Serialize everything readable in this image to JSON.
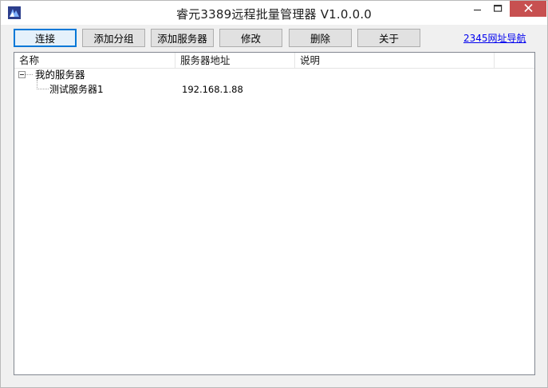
{
  "window": {
    "title": "睿元3389远程批量管理器 V1.0.0.0"
  },
  "toolbar": {
    "connect_label": "连接",
    "add_group_label": "添加分组",
    "add_server_label": "添加服务器",
    "edit_label": "修改",
    "delete_label": "删除",
    "about_label": "关于",
    "nav_link_label": "2345网址导航"
  },
  "list": {
    "columns": [
      "名称",
      "服务器地址",
      "说明"
    ],
    "groups": [
      {
        "name": "我的服务器",
        "servers": [
          {
            "name": "测试服务器1",
            "address": "192.168.1.88",
            "description": ""
          }
        ]
      }
    ]
  },
  "colors": {
    "close_button": "#c75050",
    "focus_border": "#0078d7",
    "link": "#0000ee"
  },
  "icons": {
    "app": "app-icon",
    "minimize": "minimize-icon",
    "maximize": "maximize-icon",
    "close": "close-icon",
    "expander": "tree-collapse-icon"
  }
}
